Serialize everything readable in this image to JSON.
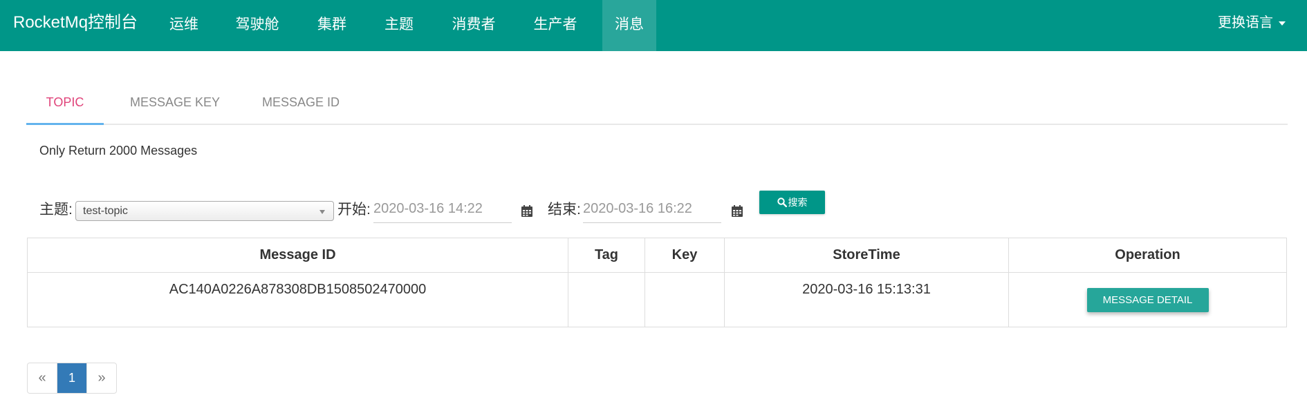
{
  "navbar": {
    "brand": "RocketMq控制台",
    "items": [
      {
        "label": "运维"
      },
      {
        "label": "驾驶舱"
      },
      {
        "label": "集群"
      },
      {
        "label": "主题"
      },
      {
        "label": "消费者"
      },
      {
        "label": "生产者"
      },
      {
        "label": "消息",
        "active": true
      }
    ],
    "language_label": "更换语言",
    "color": "#009688"
  },
  "tabs": [
    {
      "label": "TOPIC",
      "active": true
    },
    {
      "label": "MESSAGE KEY"
    },
    {
      "label": "MESSAGE ID"
    }
  ],
  "note": "Only Return 2000 Messages",
  "filters": {
    "topic_label": "主题:",
    "topic_value": "test-topic",
    "start_label": "开始:",
    "start_value": "2020-03-16 14:22",
    "end_label": "结束:",
    "end_value": "2020-03-16 16:22",
    "search_label": "搜索"
  },
  "table": {
    "columns": [
      "Message ID",
      "Tag",
      "Key",
      "StoreTime",
      "Operation"
    ],
    "rows": [
      {
        "message_id": "AC140A0226A878308DB1508502470000",
        "tag": "",
        "key": "",
        "store_time": "2020-03-16 15:13:31",
        "operation_label": "MESSAGE DETAIL"
      }
    ]
  },
  "pagination": {
    "prev": "«",
    "pages": [
      "1"
    ],
    "current": "1",
    "next": "»"
  },
  "colors": {
    "primary": "#009688",
    "active_tab_text": "#e0447a",
    "tab_underline": "#63b3ed",
    "pagination_active": "#337ab7"
  }
}
